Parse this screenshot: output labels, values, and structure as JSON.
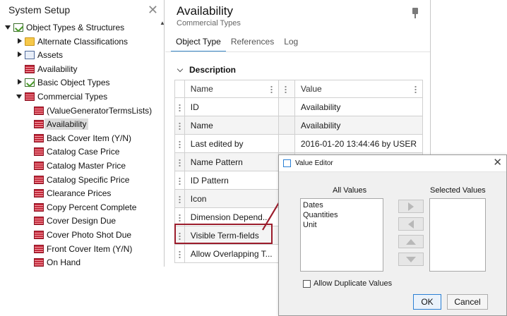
{
  "sidebar": {
    "title": "System Setup",
    "close_glyph": "✕",
    "tree": [
      {
        "label": "Object Types & Structures",
        "toggle": "open",
        "icon": "check-list-icon",
        "level": 0
      },
      {
        "label": "Alternate Classifications",
        "toggle": "closed",
        "icon": "folder-icon",
        "level": 1
      },
      {
        "label": "Assets",
        "toggle": "closed",
        "icon": "assets-icon",
        "level": 1
      },
      {
        "label": "Availability",
        "toggle": "none",
        "icon": "table-icon",
        "level": 1
      },
      {
        "label": "Basic Object Types",
        "toggle": "closed",
        "icon": "check-list-icon",
        "level": 1
      },
      {
        "label": "Commercial Types",
        "toggle": "open",
        "icon": "table-icon",
        "level": 1
      },
      {
        "label": "(ValueGeneratorTermsLists)",
        "toggle": "none",
        "icon": "table-icon",
        "level": 2
      },
      {
        "label": "Availability",
        "toggle": "none",
        "icon": "table-icon",
        "level": 2,
        "selected": true
      },
      {
        "label": "Back Cover Item (Y/N)",
        "toggle": "none",
        "icon": "table-icon",
        "level": 2
      },
      {
        "label": "Catalog Case Price",
        "toggle": "none",
        "icon": "table-icon",
        "level": 2
      },
      {
        "label": "Catalog Master Price",
        "toggle": "none",
        "icon": "table-icon",
        "level": 2
      },
      {
        "label": "Catalog Specific Price",
        "toggle": "none",
        "icon": "table-icon",
        "level": 2
      },
      {
        "label": "Clearance Prices",
        "toggle": "none",
        "icon": "table-icon",
        "level": 2
      },
      {
        "label": "Copy Percent Complete",
        "toggle": "none",
        "icon": "table-icon",
        "level": 2
      },
      {
        "label": "Cover Design Due",
        "toggle": "none",
        "icon": "table-icon",
        "level": 2
      },
      {
        "label": "Cover Photo Shot Due",
        "toggle": "none",
        "icon": "table-icon",
        "level": 2
      },
      {
        "label": "Front Cover Item (Y/N)",
        "toggle": "none",
        "icon": "table-icon",
        "level": 2
      },
      {
        "label": "On Hand",
        "toggle": "none",
        "icon": "table-icon",
        "level": 2
      }
    ]
  },
  "main": {
    "title": "Availability",
    "subtitle": "Commercial Types",
    "tabs": [
      {
        "label": "Object Type",
        "active": true
      },
      {
        "label": "References",
        "active": false
      },
      {
        "label": "Log",
        "active": false
      }
    ],
    "section_title": "Description",
    "columns": {
      "name": "Name",
      "value": "Value"
    },
    "rows": [
      {
        "name": "ID",
        "value": "Availability"
      },
      {
        "name": "Name",
        "value": "Availability"
      },
      {
        "name": "Last edited by",
        "value": "2016-01-20 13:44:46 by USER"
      },
      {
        "name": "Name Pattern",
        "value": ""
      },
      {
        "name": "ID Pattern",
        "value": ""
      },
      {
        "name": "Icon",
        "value": ""
      },
      {
        "name": "Dimension Depend...",
        "value": ""
      },
      {
        "name": "Visible Term-fields",
        "value": ""
      },
      {
        "name": "Allow Overlapping T...",
        "value": ""
      }
    ],
    "highlight_color": "#9b1c2b"
  },
  "dialog": {
    "title": "Value Editor",
    "all_values_label": "All Values",
    "selected_values_label": "Selected Values",
    "all_values": [
      "Dates",
      "Quantities",
      "Unit"
    ],
    "selected_values": [],
    "move_buttons": [
      "move-right-icon",
      "move-left-icon",
      "move-up-icon",
      "move-down-icon"
    ],
    "allow_duplicates_label": "Allow Duplicate Values",
    "allow_duplicates_checked": false,
    "ok_label": "OK",
    "cancel_label": "Cancel",
    "close_glyph": "✕"
  },
  "colors": {
    "tab_accent": "#3a8acb",
    "highlight": "#9b1c2b",
    "dialog_accent": "#2a7fd4"
  }
}
